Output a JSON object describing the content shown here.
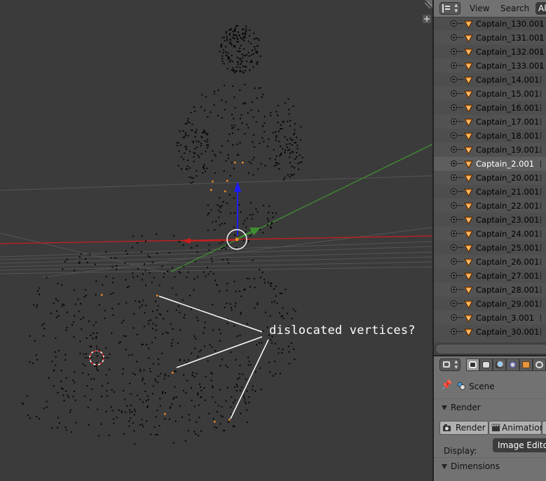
{
  "viewport": {
    "annotation": "dislocated vertices?"
  },
  "outliner": {
    "menu": {
      "view": "View",
      "search": "Search",
      "filter": "Al"
    },
    "items": [
      {
        "name": "Captain_130.001",
        "selected": false
      },
      {
        "name": "Captain_131.001",
        "selected": false
      },
      {
        "name": "Captain_132.001",
        "selected": false
      },
      {
        "name": "Captain_133.001",
        "selected": false
      },
      {
        "name": "Captain_14.001",
        "selected": false
      },
      {
        "name": "Captain_15.001",
        "selected": false
      },
      {
        "name": "Captain_16.001",
        "selected": false
      },
      {
        "name": "Captain_17.001",
        "selected": false
      },
      {
        "name": "Captain_18.001",
        "selected": false
      },
      {
        "name": "Captain_19.001",
        "selected": false
      },
      {
        "name": "Captain_2.001",
        "selected": true
      },
      {
        "name": "Captain_20.001",
        "selected": false
      },
      {
        "name": "Captain_21.001",
        "selected": false
      },
      {
        "name": "Captain_22.001",
        "selected": false
      },
      {
        "name": "Captain_23.001",
        "selected": false
      },
      {
        "name": "Captain_24.001",
        "selected": false
      },
      {
        "name": "Captain_25.001",
        "selected": false
      },
      {
        "name": "Captain_26.001",
        "selected": false
      },
      {
        "name": "Captain_27.001",
        "selected": false
      },
      {
        "name": "Captain_28.001",
        "selected": false
      },
      {
        "name": "Captain_29.001",
        "selected": false
      },
      {
        "name": "Captain_3.001",
        "selected": false
      },
      {
        "name": "Captain_30.001",
        "selected": false
      }
    ]
  },
  "properties": {
    "context_tabs": [
      "render",
      "render-layers",
      "scene",
      "world",
      "object",
      "constraints"
    ],
    "scene_label": "Scene",
    "render_panel": {
      "title": "Render",
      "render_button": "Render",
      "animation_button": "Animation",
      "display_label": "Display:",
      "display_value": "Image Editor"
    },
    "dimensions_panel": {
      "title": "Dimensions"
    }
  },
  "colors": {
    "viewport_bg": "#3b3b3b",
    "x_axis": "#c61e1e",
    "y_axis": "#3f8f2f",
    "z_axis": "#1c1cff",
    "selected_vertex": "#f08a24",
    "object_icon": "#f08a24"
  }
}
